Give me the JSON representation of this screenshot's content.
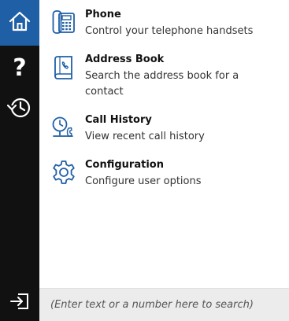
{
  "sidebar": {
    "accent_color": "#1f5fa6",
    "background": "#111111",
    "items": [
      {
        "icon": "home-icon"
      },
      {
        "icon": "help-icon",
        "glyph": "?"
      },
      {
        "icon": "history-icon"
      },
      {
        "icon": "logout-icon"
      }
    ]
  },
  "menu": {
    "icon_color": "#1f5fa6",
    "items": [
      {
        "icon": "phone-icon",
        "title": "Phone",
        "description": "Control your telephone handsets"
      },
      {
        "icon": "address-book-icon",
        "title": "Address Book",
        "description": "Search the address book for a contact"
      },
      {
        "icon": "call-history-icon",
        "title": "Call History",
        "description": "View recent call history"
      },
      {
        "icon": "configuration-icon",
        "title": "Configuration",
        "description": "Configure user options"
      }
    ]
  },
  "search": {
    "placeholder": "(Enter text or a number here to search)",
    "value": ""
  }
}
